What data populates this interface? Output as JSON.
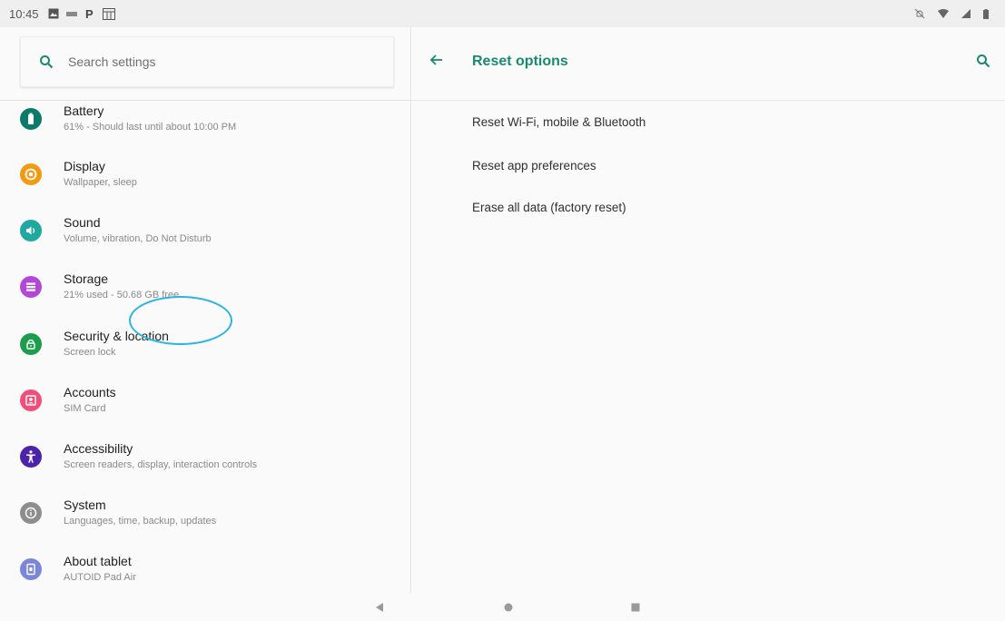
{
  "status_bar": {
    "time": "10:45",
    "left_icons": [
      "gallery-icon",
      "notification-icon",
      "parking-icon",
      "calendar-icon"
    ],
    "right_icons": [
      "mute-icon",
      "wifi-icon",
      "signal-icon",
      "battery-icon"
    ]
  },
  "search": {
    "placeholder": "Search settings",
    "icon": "search-icon"
  },
  "settings_list": [
    {
      "title": "Battery",
      "subtitle": "61% - Should last until about 10:00 PM",
      "icon": "battery-icon",
      "color": "#0b7a6b"
    },
    {
      "title": "Display",
      "subtitle": "Wallpaper, sleep",
      "icon": "brightness-icon",
      "color": "#f29a12"
    },
    {
      "title": "Sound",
      "subtitle": "Volume, vibration, Do Not Disturb",
      "icon": "volume-icon",
      "color": "#1fa8a0"
    },
    {
      "title": "Storage",
      "subtitle": "21% used - 50.68 GB free",
      "icon": "storage-icon",
      "color": "#b148d8"
    },
    {
      "title": "Security & location",
      "subtitle": "Screen lock",
      "icon": "lock-icon",
      "color": "#1e9c4d"
    },
    {
      "title": "Accounts",
      "subtitle": "SIM Card",
      "icon": "account-icon",
      "color": "#ef4f7a"
    },
    {
      "title": "Accessibility",
      "subtitle": "Screen readers, display, interaction controls",
      "icon": "accessibility-icon",
      "color": "#4a23a8"
    },
    {
      "title": "System",
      "subtitle": "Languages, time, backup, updates",
      "icon": "info-icon",
      "color": "#8d8d8d"
    },
    {
      "title": "About tablet",
      "subtitle": "AUTOID Pad Air",
      "icon": "tablet-icon",
      "color": "#7b86d8"
    }
  ],
  "reset_panel": {
    "title": "Reset options",
    "options": [
      "Reset Wi-Fi, mobile & Bluetooth",
      "Reset app preferences",
      "Erase all data (factory reset)"
    ]
  },
  "nav_bar": {
    "buttons": [
      "back-icon",
      "home-icon",
      "recents-icon"
    ]
  },
  "colors": {
    "accent": "#1a8a6e",
    "annotation": "#2ab5e3"
  }
}
